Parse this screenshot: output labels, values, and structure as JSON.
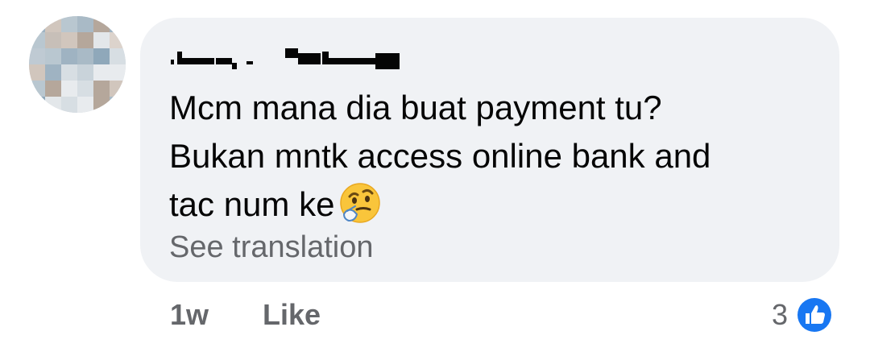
{
  "comment": {
    "author_name": "[redacted]",
    "text_lines": [
      "Mcm mana dia buat payment tu?",
      "Bukan mntk access online bank and",
      "tac num ke"
    ],
    "emoji": "thinking-face-icon",
    "see_translation": "See translation"
  },
  "footer": {
    "time": "1w",
    "like_label": "Like",
    "reaction_count": "3",
    "reaction_icon": "like-thumb-icon"
  },
  "colors": {
    "bubble_bg": "#f0f2f5",
    "text": "#050505",
    "muted": "#65676b",
    "like_blue": "#1877f2"
  }
}
